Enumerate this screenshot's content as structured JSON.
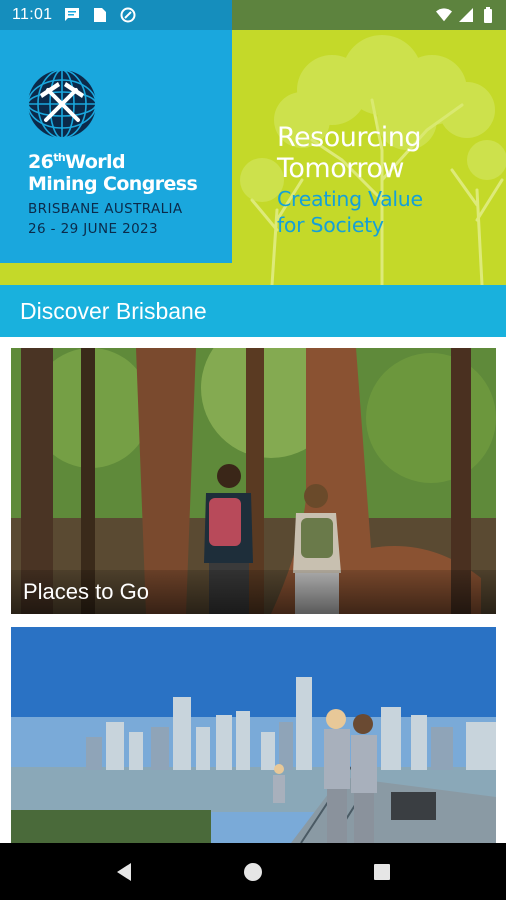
{
  "status_bar": {
    "time": "11:01",
    "icons": [
      "message-icon",
      "sim-card-icon",
      "data-saver-icon",
      "wifi-icon",
      "signal-icon",
      "battery-icon"
    ]
  },
  "banner": {
    "congress_title_prefix": "26",
    "congress_title_ordinal": "th",
    "congress_title_line1_rest": "World",
    "congress_title_line2": "Mining Congress",
    "location": "BRISBANE AUSTRALIA",
    "dates": "26 - 29 JUNE 2023",
    "tagline_line1": "Resourcing",
    "tagline_line2": "Tomorrow",
    "subtagline_line1": "Creating Value",
    "subtagline_line2": "for Society",
    "colors": {
      "lime": "#c4d929",
      "blue": "#1aa7dd",
      "navy": "#0b2a4a"
    }
  },
  "section": {
    "title": "Discover Brisbane",
    "color": "#19b1dd"
  },
  "cards": [
    {
      "caption": "Places to Go",
      "image": "rainforest-hikers-photo"
    },
    {
      "caption": "",
      "image": "brisbane-city-bridge-climb-photo"
    }
  ],
  "nav": {
    "back": "back-icon",
    "home": "home-icon",
    "recents": "recents-icon"
  }
}
